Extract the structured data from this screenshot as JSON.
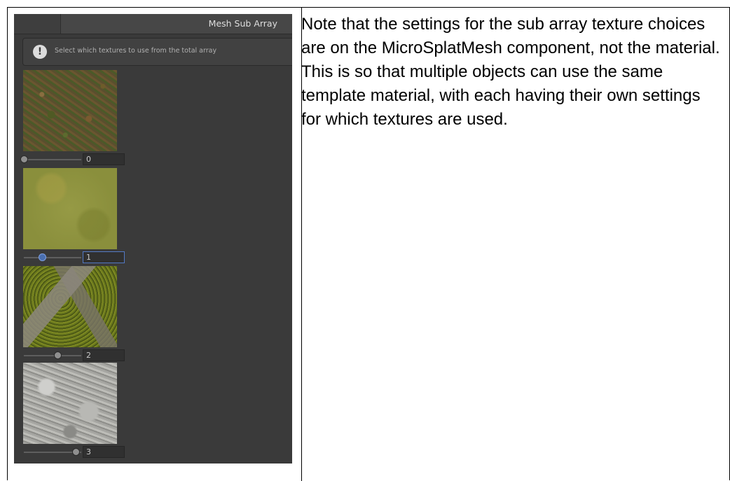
{
  "panel": {
    "header_title": "Mesh Sub Array",
    "help_text": "Select which textures to use from the total array",
    "info_icon": "exclamation-icon"
  },
  "textures": [
    {
      "index": "0",
      "slider_fraction": 0.0,
      "focused": false
    },
    {
      "index": "1",
      "slider_fraction": 0.33,
      "focused": true
    },
    {
      "index": "2",
      "slider_fraction": 0.67,
      "focused": false
    },
    {
      "index": "3",
      "slider_fraction": 1.0,
      "focused": false
    }
  ],
  "note": {
    "text": "Note that the settings for the sub array texture choices are on the MicroSplatMesh component, not the material. This is so that multiple objects can use the same template material, with each having their own settings for which textures are used."
  },
  "colors": {
    "panel_bg": "#3a3a3a",
    "focus_accent": "#5279c4"
  }
}
